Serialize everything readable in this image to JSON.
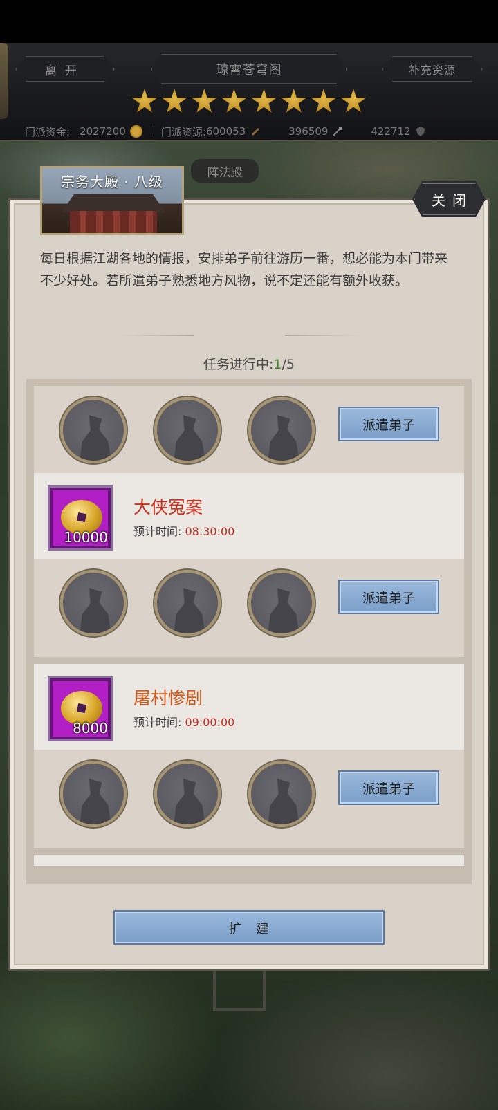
{
  "header": {
    "leave_label": "离开",
    "title": "琼霄苍穹阁",
    "supply_label": "补充资源",
    "star_count": 8,
    "resources": {
      "funds_label": "门派资金:",
      "funds_value": "2027200",
      "material_label": "门派资源:",
      "material_value": "600053",
      "res3_value": "396509",
      "res4_value": "422712"
    }
  },
  "map": {
    "hall_tag": "阵法殿"
  },
  "panel": {
    "building_title": "宗务大殿 · 八级",
    "close_label": "关闭",
    "description": "每日根据江湖各地的情报，安排弟子前往游历一番，想必能为本门带来不少好处。若所遣弟子熟悉地方风物，说不定还能有额外收获。",
    "progress_label": "任务进行中:",
    "progress_current": "1",
    "progress_total": "/5",
    "dispatch_label": "派遣弟子",
    "expand_label": "扩建"
  },
  "tasks": [
    {
      "name": "大侠冤案",
      "name_color": "#c8321f",
      "reward_amount": "10000",
      "time_label": "预计时间:",
      "time_value": "08:30:00"
    },
    {
      "name": "屠村惨剧",
      "name_color": "#d05a1c",
      "reward_amount": "8000",
      "time_label": "预计时间:",
      "time_value": "09:00:00"
    }
  ],
  "colors": {
    "accent_blue": "#89acd4",
    "reward_purple": "#b21fc4",
    "progress_green": "#3b8a2a",
    "time_red": "#b83022"
  },
  "icons": [
    "coin-icon",
    "scroll-icon",
    "sword-icon",
    "shield-icon",
    "star-icon",
    "disciple-silhouette-icon"
  ]
}
